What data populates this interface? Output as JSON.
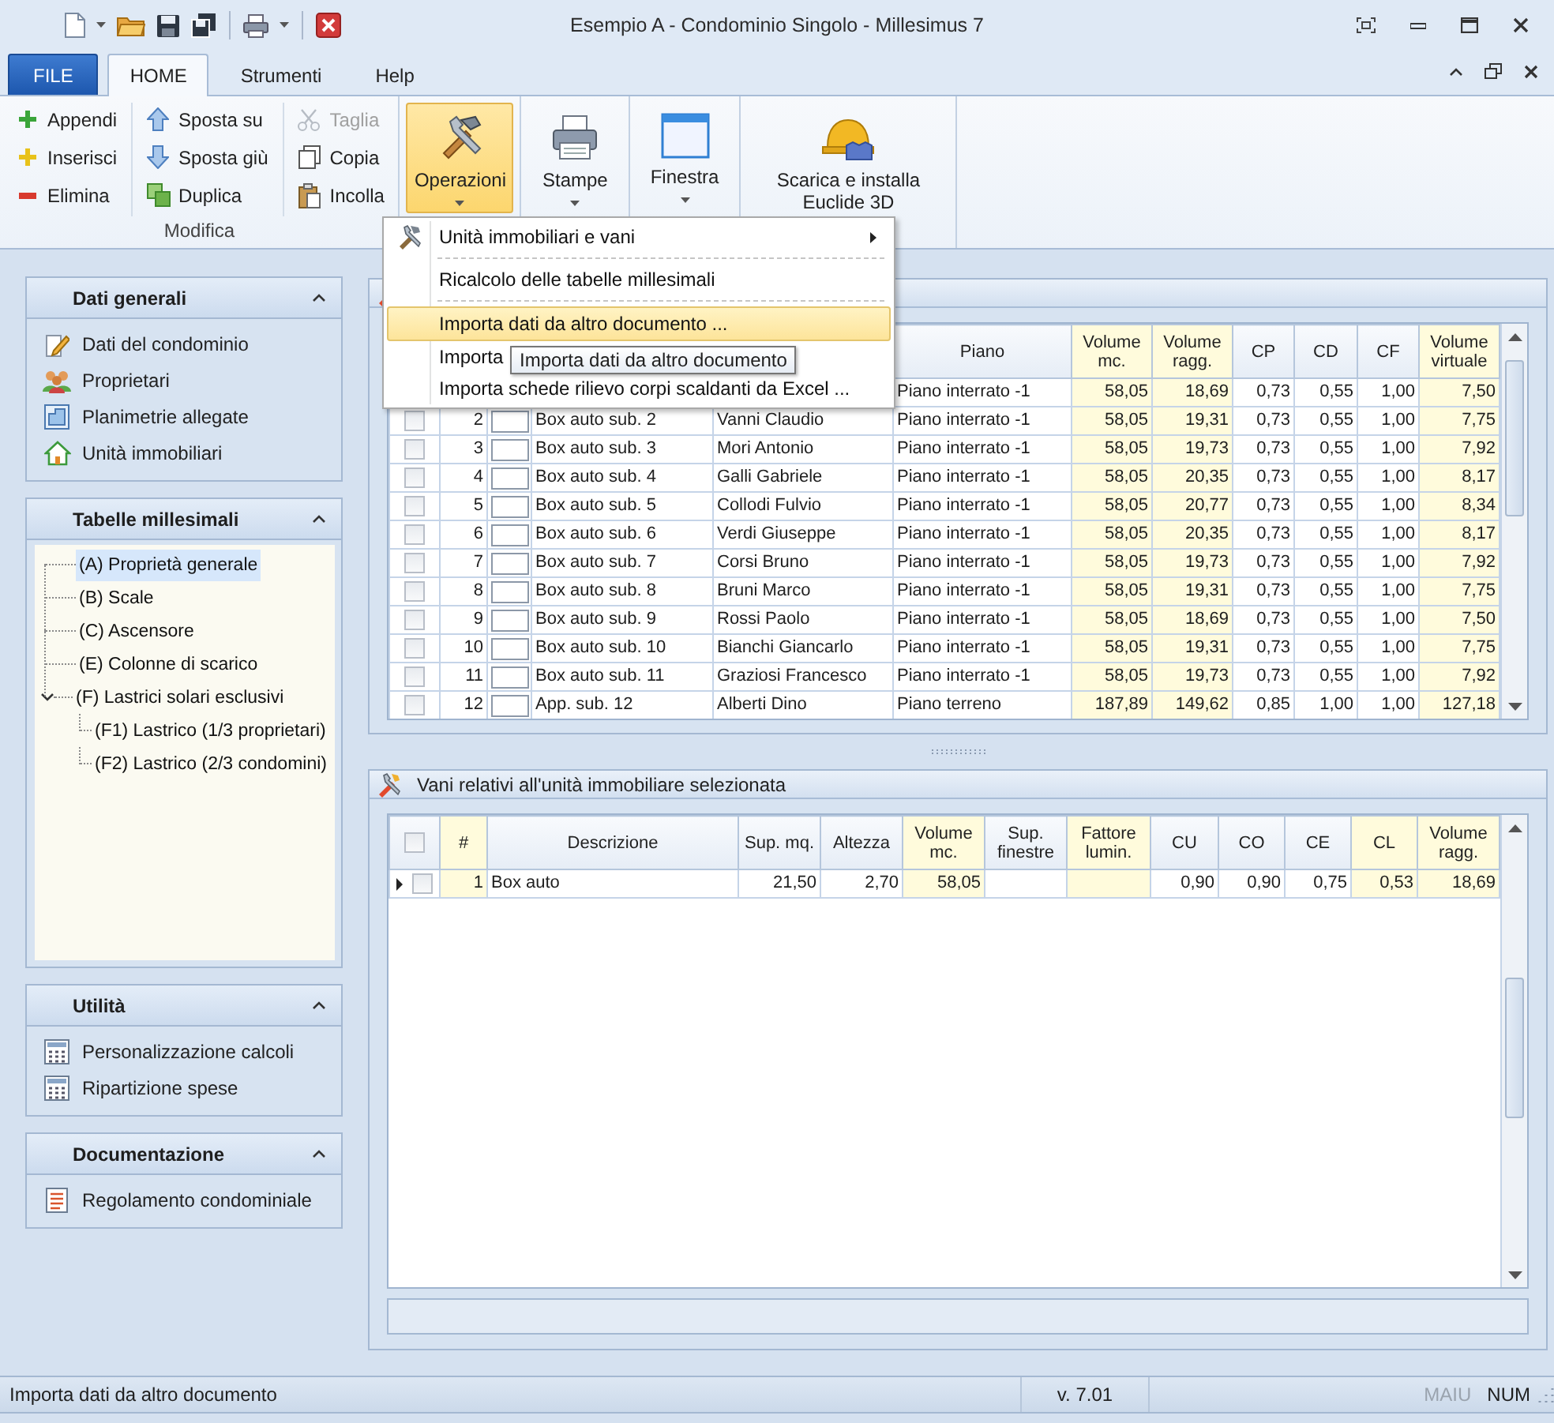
{
  "window": {
    "title": "Esempio A - Condominio Singolo - Millesimus 7"
  },
  "ribbon": {
    "tabs": [
      {
        "label": "FILE",
        "kind": "file",
        "selected": false
      },
      {
        "label": "HOME",
        "kind": "tab",
        "selected": true
      },
      {
        "label": "Strumenti",
        "kind": "tab",
        "selected": false
      },
      {
        "label": "Help",
        "kind": "tab",
        "selected": false
      }
    ],
    "edit_group": {
      "label": "Modifica",
      "columns": [
        [
          {
            "label": "Appendi",
            "disabled": false
          },
          {
            "label": "Inserisci",
            "disabled": false
          },
          {
            "label": "Elimina",
            "disabled": false
          }
        ],
        [
          {
            "label": "Sposta su",
            "disabled": false
          },
          {
            "label": "Sposta giù",
            "disabled": false
          },
          {
            "label": "Duplica",
            "disabled": false
          }
        ],
        [
          {
            "label": "Taglia",
            "disabled": true
          },
          {
            "label": "Copia",
            "disabled": false
          },
          {
            "label": "Incolla",
            "disabled": false
          }
        ]
      ]
    },
    "large_buttons": [
      {
        "label": "Operazioni",
        "pressed": true,
        "dropdown": true
      },
      {
        "label": "Stampe",
        "pressed": false,
        "dropdown": true
      },
      {
        "label": "Finestra",
        "pressed": false,
        "dropdown": true
      },
      {
        "label": "Scarica e installa Euclide 3D",
        "pressed": false,
        "dropdown": false
      }
    ]
  },
  "menu": {
    "items": [
      {
        "kind": "submenu",
        "label": "Unità immobiliari e vani",
        "highlighted": false
      },
      {
        "kind": "separator"
      },
      {
        "kind": "command",
        "label": "Ricalcolo delle tabelle millesimali",
        "highlighted": false
      },
      {
        "kind": "separator"
      },
      {
        "kind": "command",
        "label": "Importa dati da altro documento ...",
        "highlighted": true
      },
      {
        "kind": "command",
        "label": "Importa",
        "highlighted": false
      },
      {
        "kind": "command",
        "label": "Importa schede rilievo corpi scaldanti da Excel ...",
        "highlighted": false
      }
    ],
    "tooltip": "Importa dati da altro documento"
  },
  "sidebar": [
    {
      "title": "Dati generali",
      "kind": "links",
      "items": [
        {
          "label": "Dati del condominio"
        },
        {
          "label": "Proprietari"
        },
        {
          "label": "Planimetrie allegate"
        },
        {
          "label": "Unità immobiliari"
        }
      ]
    },
    {
      "title": "Tabelle millesimali",
      "kind": "tree",
      "items": [
        {
          "label": "(A) Proprietà generale",
          "selected": true
        },
        {
          "label": "(B) Scale",
          "selected": false
        },
        {
          "label": "(C) Ascensore",
          "selected": false
        },
        {
          "label": "(E) Colonne di scarico",
          "selected": false
        },
        {
          "label": "(F) Lastrici solari esclusivi",
          "selected": false,
          "expanded": true,
          "children": [
            {
              "label": "(F1) Lastrico (1/3 proprietari)",
              "selected": false
            },
            {
              "label": "(F2) Lastrico (2/3 condomini)",
              "selected": false
            }
          ]
        }
      ]
    },
    {
      "title": "Utilità",
      "kind": "links",
      "items": [
        {
          "label": "Personalizzazione calcoli"
        },
        {
          "label": "Ripartizione spese"
        }
      ]
    },
    {
      "title": "Documentazione",
      "kind": "links",
      "items": [
        {
          "label": "Regolamento condominiale"
        }
      ]
    }
  ],
  "units_table": {
    "columns": [
      {
        "label": "Piano",
        "shaded": false
      },
      {
        "label": "Volume mc.",
        "shaded": true
      },
      {
        "label": "Volume ragg.",
        "shaded": true
      },
      {
        "label": "CP",
        "shaded": false
      },
      {
        "label": "CD",
        "shaded": false
      },
      {
        "label": "CF",
        "shaded": false
      },
      {
        "label": "Volume virtuale",
        "shaded": true
      }
    ],
    "rows": [
      {
        "floor": "Piano interrato -1",
        "values": [
          "58,05",
          "18,69",
          "0,73",
          "0,55",
          "1,00",
          "7,50"
        ]
      },
      {
        "checked": false,
        "number": "2",
        "description": "Box auto sub. 2",
        "owner": "Vanni Claudio",
        "floor": "Piano interrato -1",
        "values": [
          "58,05",
          "19,31",
          "0,73",
          "0,55",
          "1,00",
          "7,75"
        ]
      },
      {
        "checked": false,
        "number": "3",
        "description": "Box auto sub. 3",
        "owner": "Mori Antonio",
        "floor": "Piano interrato -1",
        "values": [
          "58,05",
          "19,73",
          "0,73",
          "0,55",
          "1,00",
          "7,92"
        ]
      },
      {
        "checked": false,
        "number": "4",
        "description": "Box auto sub. 4",
        "owner": "Galli Gabriele",
        "floor": "Piano interrato -1",
        "values": [
          "58,05",
          "20,35",
          "0,73",
          "0,55",
          "1,00",
          "8,17"
        ]
      },
      {
        "checked": false,
        "number": "5",
        "description": "Box auto sub. 5",
        "owner": "Collodi Fulvio",
        "floor": "Piano interrato -1",
        "values": [
          "58,05",
          "20,77",
          "0,73",
          "0,55",
          "1,00",
          "8,34"
        ]
      },
      {
        "checked": false,
        "number": "6",
        "description": "Box auto sub. 6",
        "owner": "Verdi Giuseppe",
        "floor": "Piano interrato -1",
        "values": [
          "58,05",
          "20,35",
          "0,73",
          "0,55",
          "1,00",
          "8,17"
        ]
      },
      {
        "checked": false,
        "number": "7",
        "description": "Box auto sub. 7",
        "owner": "Corsi Bruno",
        "floor": "Piano interrato -1",
        "values": [
          "58,05",
          "19,73",
          "0,73",
          "0,55",
          "1,00",
          "7,92"
        ]
      },
      {
        "checked": false,
        "number": "8",
        "description": "Box auto sub. 8",
        "owner": "Bruni Marco",
        "floor": "Piano interrato -1",
        "values": [
          "58,05",
          "19,31",
          "0,73",
          "0,55",
          "1,00",
          "7,75"
        ]
      },
      {
        "checked": false,
        "number": "9",
        "description": "Box auto sub. 9",
        "owner": "Rossi Paolo",
        "floor": "Piano interrato -1",
        "values": [
          "58,05",
          "18,69",
          "0,73",
          "0,55",
          "1,00",
          "7,50"
        ]
      },
      {
        "checked": false,
        "number": "10",
        "description": "Box auto sub. 10",
        "owner": "Bianchi Giancarlo",
        "floor": "Piano interrato -1",
        "values": [
          "58,05",
          "19,31",
          "0,73",
          "0,55",
          "1,00",
          "7,75"
        ]
      },
      {
        "checked": false,
        "number": "11",
        "description": "Box auto sub. 11",
        "owner": "Graziosi Francesco",
        "floor": "Piano interrato -1",
        "values": [
          "58,05",
          "19,73",
          "0,73",
          "0,55",
          "1,00",
          "7,92"
        ]
      },
      {
        "checked": false,
        "number": "12",
        "description": "App. sub. 12",
        "owner": "Alberti Dino",
        "floor": "Piano terreno",
        "values": [
          "187,89",
          "149,62",
          "0,85",
          "1,00",
          "1,00",
          "127,18"
        ]
      }
    ]
  },
  "rooms_panel": {
    "title": "Vani relativi all'unità immobiliare selezionata",
    "all_checked": false,
    "columns": [
      {
        "label": "#",
        "shaded": true
      },
      {
        "label": "Descrizione",
        "shaded": false
      },
      {
        "label": "Sup. mq.",
        "shaded": false
      },
      {
        "label": "Altezza",
        "shaded": false
      },
      {
        "label": "Volume mc.",
        "shaded": true
      },
      {
        "label": "Sup. finestre",
        "shaded": false
      },
      {
        "label": "Fattore lumin.",
        "shaded": true
      },
      {
        "label": "CU",
        "shaded": false
      },
      {
        "label": "CO",
        "shaded": false
      },
      {
        "label": "CE",
        "shaded": false
      },
      {
        "label": "CL",
        "shaded": true
      },
      {
        "label": "Volume ragg.",
        "shaded": true
      }
    ],
    "rows": [
      {
        "current": true,
        "checked": false,
        "cells": [
          "1",
          "Box auto",
          "21,50",
          "2,70",
          "58,05",
          null,
          null,
          "0,90",
          "0,90",
          "0,75",
          "0,53",
          "18,69"
        ]
      }
    ]
  },
  "status_bar": {
    "message": "Importa dati da altro documento",
    "version": "v. 7.01",
    "indicators": [
      {
        "label": "MAIU",
        "on": false
      },
      {
        "label": "NUM",
        "on": true
      }
    ]
  }
}
